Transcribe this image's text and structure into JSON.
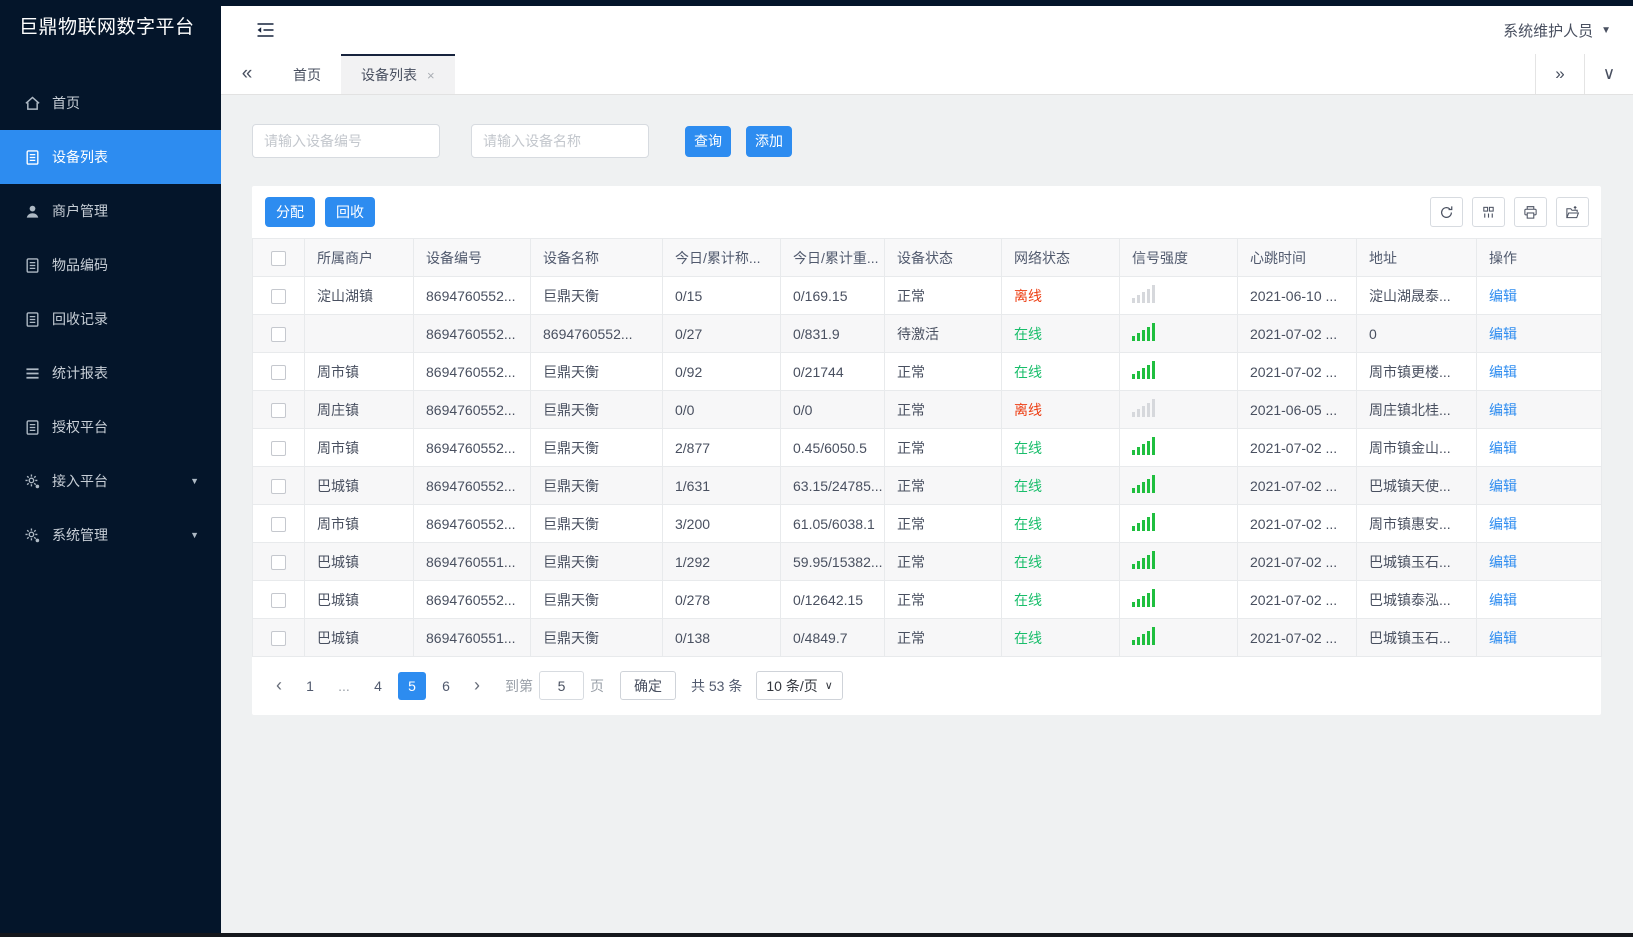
{
  "app": {
    "logo": "巨鼎物联网数字平台",
    "user": "系统维护人员"
  },
  "colors": {
    "primary": "#2d8cf0",
    "success": "#19be6b",
    "error": "#ed3f14",
    "sidebar_bg": "#04152a"
  },
  "glyphs": {
    "collapse_left": "«",
    "expand_right": "»",
    "chevron_down": "∨",
    "tab_close": "×",
    "caret_down": "▼",
    "submenu_caret": "▼",
    "pager_prev": "‹",
    "pager_next": "›",
    "select_caret": "∨"
  },
  "sidebar": {
    "items": [
      {
        "label": "首页",
        "icon": "home-icon",
        "active": false,
        "expandable": false
      },
      {
        "label": "设备列表",
        "icon": "device-list-icon",
        "active": true,
        "expandable": false
      },
      {
        "label": "商户管理",
        "icon": "merchant-icon",
        "active": false,
        "expandable": false
      },
      {
        "label": "物品编码",
        "icon": "item-code-icon",
        "active": false,
        "expandable": false
      },
      {
        "label": "回收记录",
        "icon": "recycle-record-icon",
        "active": false,
        "expandable": false
      },
      {
        "label": "统计报表",
        "icon": "report-icon",
        "active": false,
        "expandable": false
      },
      {
        "label": "授权平台",
        "icon": "authorize-icon",
        "active": false,
        "expandable": false
      },
      {
        "label": "接入平台",
        "icon": "access-gear-icon",
        "active": false,
        "expandable": true
      },
      {
        "label": "系统管理",
        "icon": "system-gear-icon",
        "active": false,
        "expandable": true
      }
    ]
  },
  "tabs": [
    {
      "label": "首页",
      "active": false
    },
    {
      "label": "设备列表",
      "active": true
    }
  ],
  "search": {
    "device_no_placeholder": "请输入设备编号",
    "device_name_placeholder": "请输入设备名称",
    "query_label": "查询",
    "add_label": "添加"
  },
  "toolbar": {
    "assign_label": "分配",
    "recycle_label": "回收"
  },
  "table": {
    "headers": [
      "所属商户",
      "设备编号",
      "设备名称",
      "今日/累计称...",
      "今日/累计重...",
      "设备状态",
      "网络状态",
      "信号强度",
      "心跳时间",
      "地址",
      "操作"
    ],
    "edit_label": "编辑",
    "rows": [
      {
        "merchant": "淀山湖镇",
        "device_no": "8694760552...",
        "device_name": "巨鼎天衡",
        "today_count": "0/15",
        "today_weight": "0/169.15",
        "status": "正常",
        "network": "离线",
        "online": false,
        "heartbeat": "2021-06-10 ...",
        "address": "淀山湖晟泰..."
      },
      {
        "merchant": "",
        "device_no": "8694760552...",
        "device_name": "8694760552...",
        "today_count": "0/27",
        "today_weight": "0/831.9",
        "status": "待激活",
        "network": "在线",
        "online": true,
        "heartbeat": "2021-07-02 ...",
        "address": "0"
      },
      {
        "merchant": "周市镇",
        "device_no": "8694760552...",
        "device_name": "巨鼎天衡",
        "today_count": "0/92",
        "today_weight": "0/21744",
        "status": "正常",
        "network": "在线",
        "online": true,
        "heartbeat": "2021-07-02 ...",
        "address": "周市镇更楼..."
      },
      {
        "merchant": "周庄镇",
        "device_no": "8694760552...",
        "device_name": "巨鼎天衡",
        "today_count": "0/0",
        "today_weight": "0/0",
        "status": "正常",
        "network": "离线",
        "online": false,
        "heartbeat": "2021-06-05 ...",
        "address": "周庄镇北桂..."
      },
      {
        "merchant": "周市镇",
        "device_no": "8694760552...",
        "device_name": "巨鼎天衡",
        "today_count": "2/877",
        "today_weight": "0.45/6050.5",
        "status": "正常",
        "network": "在线",
        "online": true,
        "heartbeat": "2021-07-02 ...",
        "address": "周市镇金山..."
      },
      {
        "merchant": "巴城镇",
        "device_no": "8694760552...",
        "device_name": "巨鼎天衡",
        "today_count": "1/631",
        "today_weight": "63.15/24785...",
        "status": "正常",
        "network": "在线",
        "online": true,
        "heartbeat": "2021-07-02 ...",
        "address": "巴城镇天使..."
      },
      {
        "merchant": "周市镇",
        "device_no": "8694760552...",
        "device_name": "巨鼎天衡",
        "today_count": "3/200",
        "today_weight": "61.05/6038.1",
        "status": "正常",
        "network": "在线",
        "online": true,
        "heartbeat": "2021-07-02 ...",
        "address": "周市镇惠安..."
      },
      {
        "merchant": "巴城镇",
        "device_no": "8694760551...",
        "device_name": "巨鼎天衡",
        "today_count": "1/292",
        "today_weight": "59.95/15382...",
        "status": "正常",
        "network": "在线",
        "online": true,
        "heartbeat": "2021-07-02 ...",
        "address": "巴城镇玉石..."
      },
      {
        "merchant": "巴城镇",
        "device_no": "8694760552...",
        "device_name": "巨鼎天衡",
        "today_count": "0/278",
        "today_weight": "0/12642.15",
        "status": "正常",
        "network": "在线",
        "online": true,
        "heartbeat": "2021-07-02 ...",
        "address": "巴城镇泰泓..."
      },
      {
        "merchant": "巴城镇",
        "device_no": "8694760551...",
        "device_name": "巨鼎天衡",
        "today_count": "0/138",
        "today_weight": "0/4849.7",
        "status": "正常",
        "network": "在线",
        "online": true,
        "heartbeat": "2021-07-02 ...",
        "address": "巴城镇玉石..."
      }
    ]
  },
  "pagination": {
    "pages": [
      "1",
      "...",
      "4",
      "5",
      "6"
    ],
    "active": "5",
    "goto_label": "到第",
    "goto_value": "5",
    "page_unit": "页",
    "confirm_label": "确定",
    "total": "共 53 条",
    "page_size": "10 条/页"
  }
}
